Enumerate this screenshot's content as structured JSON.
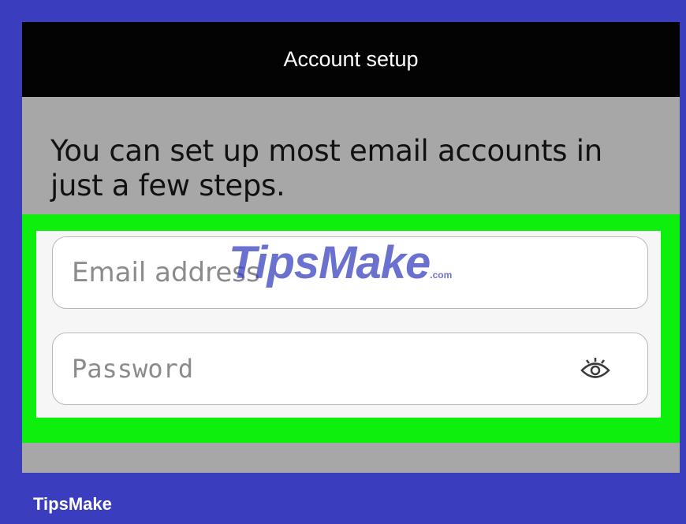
{
  "appbar": {
    "title": "Account setup"
  },
  "intro": {
    "text": "You can set up most email accounts in just a few steps."
  },
  "form": {
    "email_placeholder": "Email address",
    "password_placeholder": "Password",
    "password_toggle_icon": "eye-icon"
  },
  "watermark": {
    "text": "TipsMake",
    "suffix": ".com"
  },
  "brand": {
    "label": "TipsMake"
  },
  "colors": {
    "background": "#3a3dbd",
    "appbar": "#030303",
    "content": "#a7a7a7",
    "highlight": "#0df00d",
    "panel": "#f6f6f6"
  }
}
